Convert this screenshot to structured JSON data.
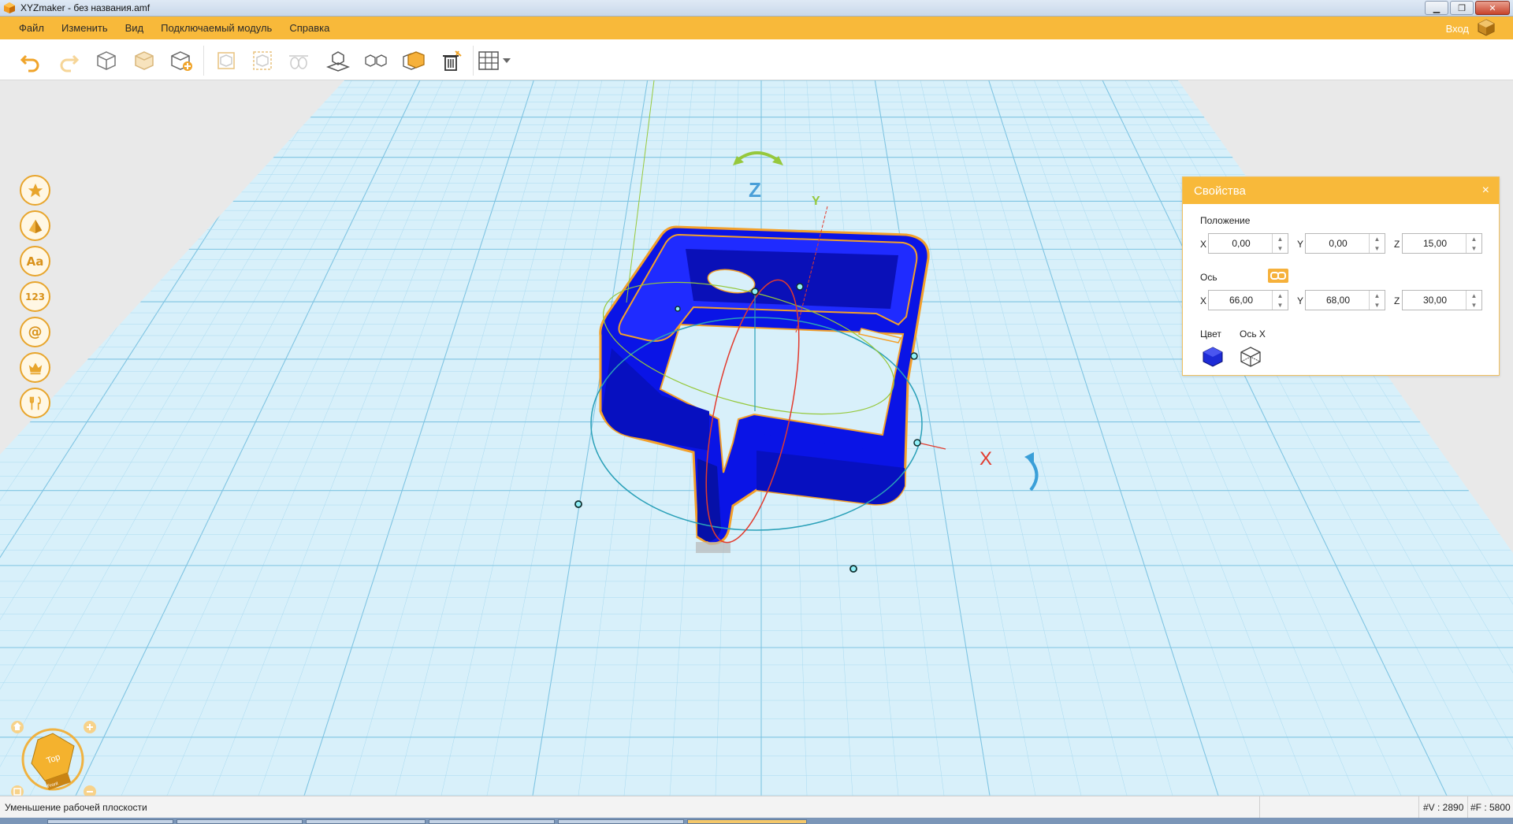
{
  "window": {
    "title": "XYZmaker - без названия.amf",
    "minimize": "▁",
    "restore": "❐",
    "close": "✕"
  },
  "menu": {
    "items": [
      {
        "label": "Файл"
      },
      {
        "label": "Изменить"
      },
      {
        "label": "Вид"
      },
      {
        "label": "Подключаемый модуль"
      },
      {
        "label": "Справка"
      }
    ],
    "login": "Вход"
  },
  "toolbar": {
    "tools": [
      {
        "name": "undo",
        "icon": "undo-icon"
      },
      {
        "name": "redo",
        "icon": "redo-icon"
      },
      {
        "name": "new-object",
        "icon": "cube-outline-icon"
      },
      {
        "name": "copy",
        "icon": "cube-copy-icon"
      },
      {
        "name": "add-object",
        "icon": "cube-add-icon"
      },
      {
        "name": "group",
        "icon": "group-icon"
      },
      {
        "name": "ungroup",
        "icon": "ungroup-icon"
      },
      {
        "name": "align",
        "icon": "align-icon"
      },
      {
        "name": "place-on-plane",
        "icon": "place-on-plane-icon"
      },
      {
        "name": "mirror",
        "icon": "mirror-icon"
      },
      {
        "name": "fill",
        "icon": "fill-cube-icon"
      },
      {
        "name": "delete",
        "icon": "trash-icon"
      },
      {
        "name": "grid",
        "icon": "grid-icon"
      }
    ]
  },
  "palette": {
    "items": [
      {
        "name": "favorites",
        "icon": "star-icon"
      },
      {
        "name": "shapes",
        "icon": "pyramid-icon"
      },
      {
        "name": "text",
        "icon": "text-icon",
        "text": "Aa"
      },
      {
        "name": "numbers",
        "icon": "numbers-icon",
        "text": "123"
      },
      {
        "name": "symbols",
        "icon": "at-icon",
        "text": "@"
      },
      {
        "name": "crown",
        "icon": "crown-icon"
      },
      {
        "name": "tools",
        "icon": "fork-knife-icon"
      }
    ]
  },
  "gizmo": {
    "z_label": "Z",
    "y_label": "Y",
    "x_label": "X"
  },
  "properties": {
    "title": "Свойства",
    "close": "×",
    "position_label": "Положение",
    "position": {
      "x": "0,00",
      "y": "0,00",
      "z": "15,00"
    },
    "axis_label": "Ось",
    "axis": {
      "x": "66,00",
      "y": "68,00",
      "z": "30,00"
    },
    "axis_names": {
      "x": "X",
      "y": "Y",
      "z": "Z"
    },
    "color_label": "Цвет",
    "axis_x_label": "Ось X",
    "color_value": "#1d2bd6",
    "spin_up": "▲",
    "spin_down": "▼"
  },
  "viewcube": {
    "face_top": "Top",
    "face_front": "Front"
  },
  "status": {
    "message": "Уменьшение рабочей плоскости",
    "vertices": "#V : 2890",
    "faces": "#F : 5800"
  },
  "colors": {
    "accent": "#f8b93a",
    "model": "#0a14e6",
    "grid": "#8ccbe6"
  }
}
